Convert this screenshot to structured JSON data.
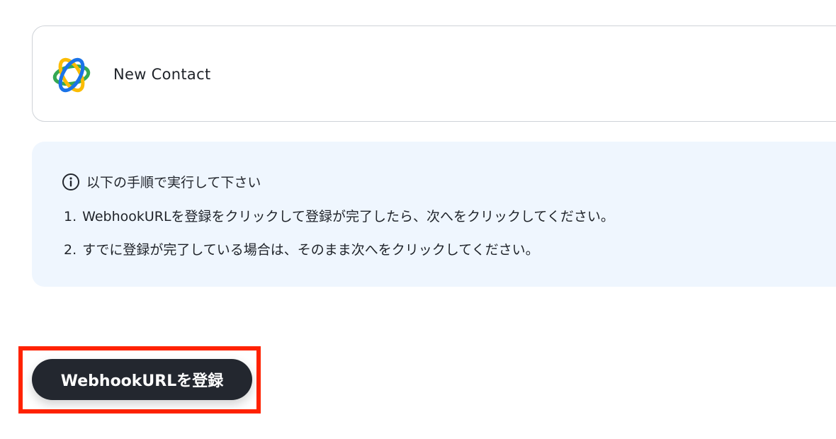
{
  "trigger": {
    "title": "New Contact",
    "logo_icon": "app-logo-icon",
    "logo_colors": [
      "#1a73e8",
      "#34a853",
      "#fbbc04"
    ]
  },
  "instructions": {
    "icon": "info-icon",
    "heading": "以下の手順で実行して下さい",
    "steps": [
      {
        "num": "1.",
        "text": "WebhookURLを登録をクリックして登録が完了したら、次へをクリックしてください。"
      },
      {
        "num": "2.",
        "text": "すでに登録が完了している場合は、そのまま次へをクリックしてください。"
      }
    ]
  },
  "actions": {
    "register_label": "WebhookURLを登録"
  },
  "colors": {
    "info_background": "#eff6fe",
    "button_background": "#23272f",
    "highlight_border": "#ff2200"
  }
}
